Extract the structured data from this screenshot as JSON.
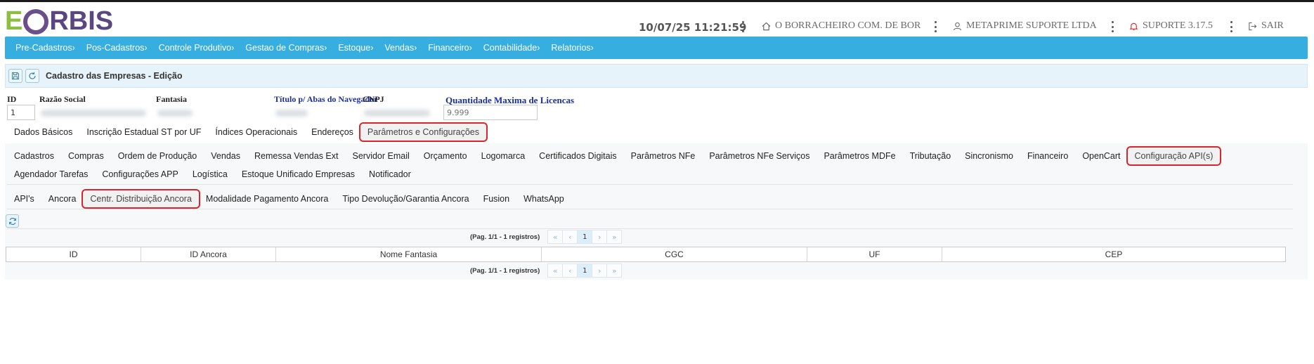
{
  "brand": {
    "e": "E",
    "rest": "RBIS"
  },
  "header": {
    "datetime": "10/07/25 11:21:59",
    "company": "O BORRACHEIRO COM. DE BOR",
    "user": "METAPRIME SUPORTE LTDA",
    "support": "SUPORTE 3.17.5",
    "logout": "SAIR"
  },
  "nav": [
    "Pre-Cadastros›",
    "Pos-Cadastros›",
    "Controle Produtivo›",
    "Gestao de Compras›",
    "Estoque›",
    "Vendas›",
    "Financeiro›",
    "Contabilidade›",
    "Relatorios›"
  ],
  "page": {
    "title": "Cadastro das Empresas - Edição"
  },
  "fields": {
    "id_label": "ID",
    "id_value": "1",
    "razao_label": "Razão Social",
    "fantasia_label": "Fantasia",
    "titulo_label": "Título p/ Abas do Navegador",
    "cnpj_label": "CNPJ",
    "licencas_label": "Quantidade Maxima de Licencas",
    "licencas_placeholder": "9.999"
  },
  "tabs_main": [
    "Dados Básicos",
    "Inscrição Estadual ST por UF",
    "Índices Operacionais",
    "Endereços",
    "Parâmetros e Configurações"
  ],
  "tabs_main_active": "Parâmetros e Configurações",
  "tabs_sub_row1": [
    "Cadastros",
    "Compras",
    "Ordem de Produção",
    "Vendas",
    "Remessa Vendas Ext",
    "Servidor Email",
    "Orçamento",
    "Logomarca",
    "Certificados Digitais",
    "Parâmetros NFe",
    "Parâmetros NFe Serviços",
    "Parâmetros MDFe",
    "Tributação",
    "Sincronismo",
    "Financeiro",
    "OpenCart",
    "Configuração API(s)"
  ],
  "tabs_sub_row2": [
    "Agendador Tarefas",
    "Configurações APP",
    "Logística",
    "Estoque Unificado Empresas",
    "Notificador"
  ],
  "tabs_sub_active": "Configuração API(s)",
  "tabs_api": [
    "API's",
    "Ancora",
    "Centr. Distribuição Ancora",
    "Modalidade Pagamento Ancora",
    "Tipo Devolução/Garantia Ancora",
    "Fusion",
    "WhatsApp"
  ],
  "tabs_api_active": "Centr. Distribuição Ancora",
  "pager": {
    "info": "(Pag. 1/1 - 1 registros)",
    "first": "«",
    "prev": "‹",
    "current": "1",
    "next": "›",
    "last": "»"
  },
  "table": {
    "columns": [
      "ID",
      "ID Ancora",
      "Nome Fantasia",
      "CGC",
      "UF",
      "CEP"
    ]
  },
  "colors": {
    "nav": "#36aee0",
    "highlight": "#d9262c",
    "brand_green": "#8cbf3f",
    "brand_purple": "#5a4780"
  }
}
